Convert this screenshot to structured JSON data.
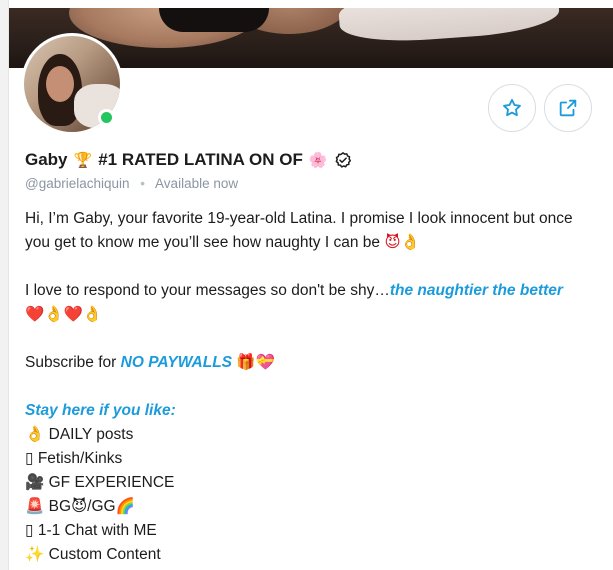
{
  "profile": {
    "name": "Gaby",
    "title_emoji_trophy": "🏆",
    "tagline": "#1 RATED LATINA ON OF",
    "title_emoji_flower": "🌸",
    "verified_icon": "verified-badge-icon",
    "handle": "@gabrielachiquin",
    "separator": "•",
    "status": "Available now",
    "online": true
  },
  "actions": {
    "favorite_icon": "star-icon",
    "share_icon": "share-icon"
  },
  "bio": {
    "line1": "Hi, I’m Gaby, your favorite 19-year-old Latina. I promise I look innocent but once",
    "line2_text": "you get to know me you’ll see how naughty I can be ",
    "line2_emoji": "😈👌",
    "line3_text": "I love to respond to your messages so don't be shy…",
    "line3_accent": "the naughtier the better",
    "line4_emoji": "❤️👌❤️👌",
    "line5_text": "Subscribe for ",
    "line5_accent": "NO PAYWALLS",
    "line5_emoji": "🎁💝",
    "list_heading": "Stay here if you like:",
    "list_items": [
      {
        "icon": "👌",
        "text": "DAILY posts"
      },
      {
        "icon": "▯",
        "text": "Fetish/Kinks"
      },
      {
        "icon": "🎥",
        "text": "GF EXPERIENCE"
      },
      {
        "icon": "🚨",
        "text": "BG😈/GG🌈"
      },
      {
        "icon": "▯",
        "text": "1-1 Chat with ME"
      },
      {
        "icon": "✨",
        "text": "Custom Content"
      }
    ]
  },
  "colors": {
    "accent": "#1b9bdb",
    "online": "#22c55e",
    "muted": "#8a96a3"
  }
}
